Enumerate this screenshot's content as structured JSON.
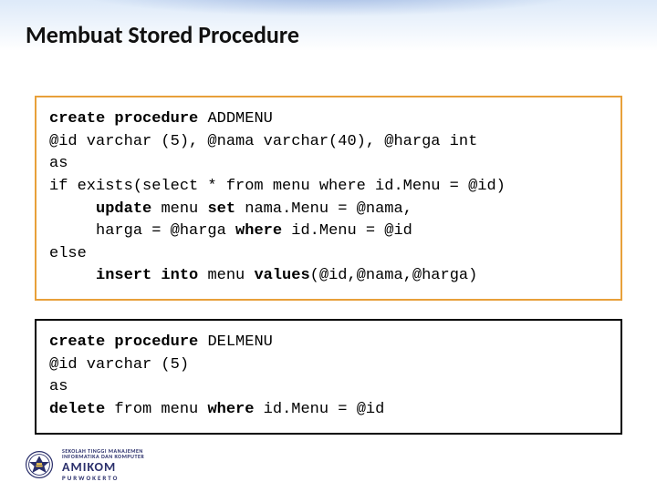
{
  "title": "Membuat Stored Procedure",
  "code1": {
    "l1a": "create procedure ",
    "l1b": "ADDMENU",
    "l2": "@id varchar (5), @nama varchar(40), @harga int",
    "l3": "as",
    "l4": "if exists(select * from menu where id.Menu = @id)",
    "l5a": "     ",
    "l5b": "update ",
    "l5c": "menu ",
    "l5d": "set ",
    "l5e": "nama.Menu = @nama,",
    "l6": "     harga = @harga ",
    "l6b": "where ",
    "l6c": "id.Menu = @id",
    "l7": "else",
    "l8a": "     ",
    "l8b": "insert into ",
    "l8c": "menu ",
    "l8d": "values",
    "l8e": "(@id,@nama,@harga)"
  },
  "code2": {
    "l1a": "create procedure ",
    "l1b": "DELMENU",
    "l2": "@id varchar (5)",
    "l3": "as",
    "l4a": "delete ",
    "l4b": "from menu ",
    "l4c": "where ",
    "l4d": "id.Menu = @id"
  },
  "footer": {
    "line1": "SEKOLAH TINGGI MANAJEMEN",
    "line2": "INFORMATIKA DAN KOMPUTER",
    "brand": "AMIKOM",
    "city": "PURWOKERTO"
  }
}
